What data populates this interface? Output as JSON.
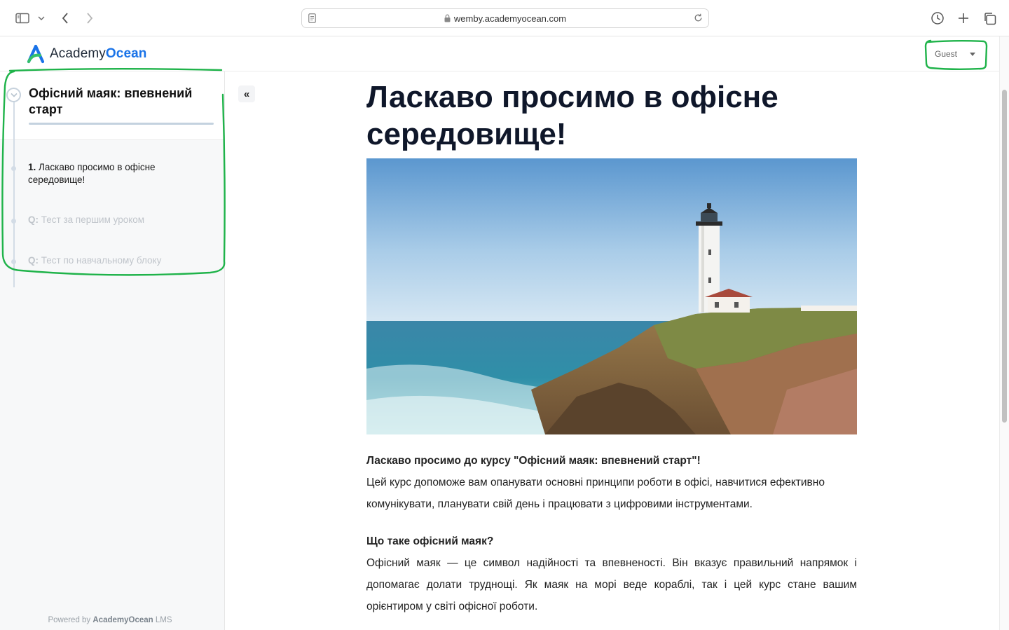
{
  "browser": {
    "url": "wemby.academyocean.com"
  },
  "header": {
    "logo_academy": "Academy",
    "logo_ocean": "Ocean",
    "user_label": "Guest"
  },
  "sidebar": {
    "course_title": "Офісний маяк: впевнений старт",
    "lessons": [
      {
        "number": "1.",
        "title": "Ласкаво просимо в офісне середовище!",
        "state": "active"
      },
      {
        "prefix": "Q:",
        "title": "Тест за першим уроком",
        "state": "locked"
      },
      {
        "prefix": "Q:",
        "title": "Тест по навчальному блоку",
        "state": "locked"
      }
    ],
    "powered_prefix": "Powered by",
    "powered_brand": "AcademyOcean",
    "powered_suffix": "LMS"
  },
  "main": {
    "collapse_label": "«",
    "title": "Ласкаво просимо в офісне середовище!",
    "intro_heading": "Ласкаво просимо до курсу \"Офісний маяк: впевнений старт\"!",
    "intro_text": "Цей курс допоможе вам опанувати основні принципи роботи в офісі, навчитися ефективно комунікувати, планувати свій день і працювати з цифровими інструментами.",
    "section_heading": "Що таке офісний маяк?",
    "section_text": "Офісний маяк — це символ надійності та впевненості. Він вказує правильний напрямок і допомагає долати труднощі. Як маяк на морі веде кораблі, так і цей курс стане вашим орієнтиром у світі офісної роботи."
  },
  "icons": {
    "sidebar_toggle": "sidebar-toggle-icon",
    "back": "chevron-left-icon",
    "forward": "chevron-right-icon",
    "reader": "reader-icon",
    "lock": "lock-icon",
    "reload": "reload-icon",
    "history": "clock-icon",
    "new_tab": "plus-icon",
    "tabs": "tabs-overview-icon"
  },
  "colors": {
    "brand_blue": "#1a73e8",
    "annotation_green": "#1fb34a"
  }
}
